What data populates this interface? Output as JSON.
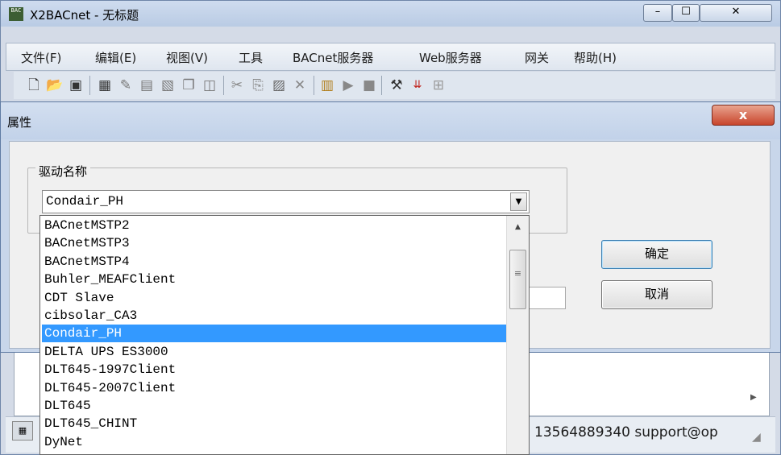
{
  "window": {
    "title": "X2BACnet - 无标题",
    "app_icon_text": "BAC"
  },
  "menu": [
    "文件(F)",
    "编辑(E)",
    "视图(V)",
    "工具",
    "BACnet服务器",
    "Web服务器",
    "网关",
    "帮助(H)"
  ],
  "toolbar_icons": [
    "new-file-icon",
    "open-folder-icon",
    "save-icon",
    "calculator-icon",
    "pin-icon",
    "grid-icon",
    "camera-icon",
    "copy-window-icon",
    "window-icon",
    "cut-icon",
    "copy-icon",
    "paste-icon",
    "delete-icon",
    "stack-icon",
    "play-icon",
    "stop-icon",
    "tools-icon",
    "load-icon",
    "tree-icon"
  ],
  "status": {
    "text": "13564889340 support@op"
  },
  "dialog": {
    "title": "属性",
    "close_glyph": "x",
    "group_label": "驱动名称",
    "combo_value": "Condair_PH",
    "ok_label": "确定",
    "cancel_label": "取消"
  },
  "dropdown": {
    "selected": "Condair_PH",
    "options": [
      "BACnetMSTP2",
      "BACnetMSTP3",
      "BACnetMSTP4",
      "Buhler_MEAFClient",
      "CDT Slave",
      "cibsolar_CA3",
      "Condair_PH",
      "DELTA UPS ES3000",
      "DLT645-1997Client",
      "DLT645-2007Client",
      "DLT645",
      "DLT645_CHINT",
      "DyNet"
    ]
  },
  "colors": {
    "selection": "#3399ff",
    "close_button": "#c8452c"
  }
}
